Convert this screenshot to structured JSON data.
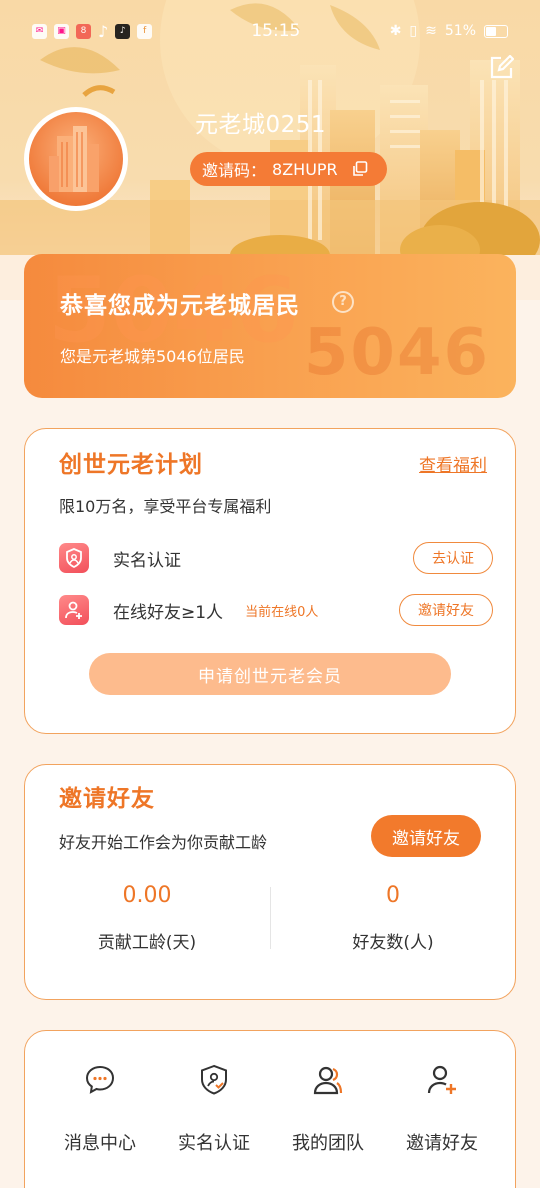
{
  "status_bar": {
    "time": "15:15",
    "battery": "51%",
    "app_icons": [
      "mail-icon",
      "photo-icon",
      "app-icon",
      "tiktok-icon",
      "tiktok-lite-icon",
      "facebook-icon"
    ]
  },
  "profile": {
    "username": "元老城0251",
    "invite_code_label": "邀请码：",
    "invite_code": "8ZHUPR"
  },
  "resident": {
    "title": "恭喜您成为元老城居民",
    "subtitle": "您是元老城第5046位居民",
    "watermark_number": "5046"
  },
  "genesis_plan": {
    "title": "创世元老计划",
    "view_benefits": "查看福利",
    "description": "限10万名，享受平台专属福利",
    "tasks": [
      {
        "label": "实名认证",
        "hint": "",
        "button": "去认证"
      },
      {
        "label": "在线好友≥1人",
        "hint": "当前在线0人",
        "button": "邀请好友"
      }
    ],
    "apply_button": "申请创世元老会员"
  },
  "invite_section": {
    "title": "邀请好友",
    "description": "好友开始工作会为你贡献工龄",
    "button": "邀请好友",
    "stats": [
      {
        "value": "0.00",
        "label": "贡献工龄(天)"
      },
      {
        "value": "0",
        "label": "好友数(人)"
      }
    ]
  },
  "menu": {
    "items": [
      {
        "label": "消息中心",
        "icon": "message-icon"
      },
      {
        "label": "实名认证",
        "icon": "verify-shield-icon"
      },
      {
        "label": "我的团队",
        "icon": "team-icon"
      },
      {
        "label": "邀请好友",
        "icon": "add-friend-icon"
      }
    ]
  },
  "colors": {
    "accent": "#ee7627",
    "accent_light": "#fdbb8d",
    "card_border": "#f2a35e",
    "background": "#fdf3ea"
  }
}
